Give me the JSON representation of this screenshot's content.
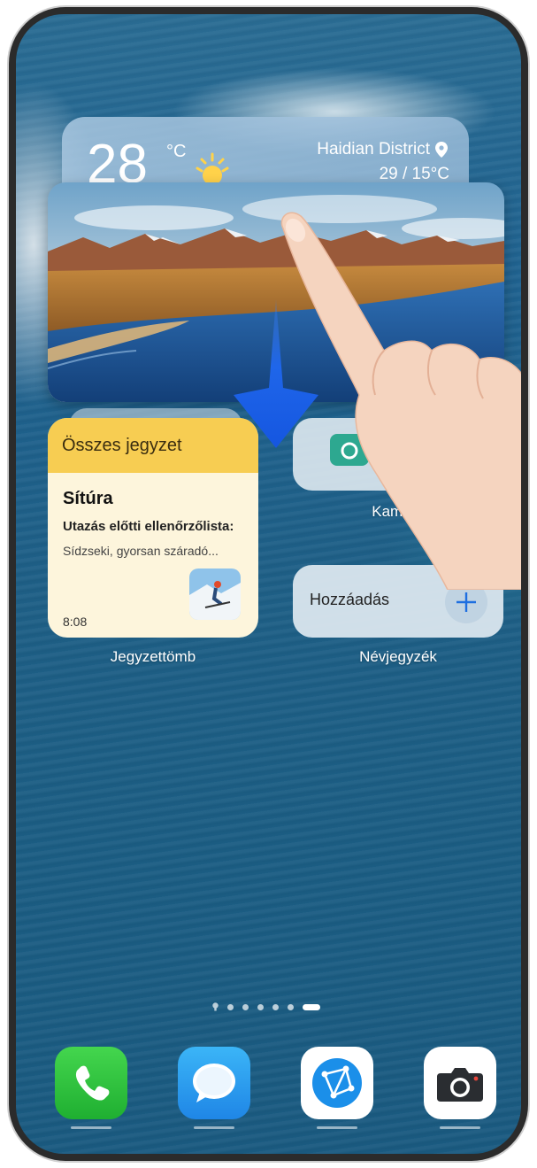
{
  "weather": {
    "temperature": "28",
    "unit": "°C",
    "location": "Haidian District",
    "range": "29 / 15°C",
    "icon": "sun-icon"
  },
  "notes_widget": {
    "header": "Összes jegyzet",
    "title": "Sítúra",
    "line1": "Utazás előtti ellenőrzőlista:",
    "line2": "Sídzseki, gyorsan száradó...",
    "time": "8:08",
    "app_label": "Jegyzettömb"
  },
  "camera_widget": {
    "app_label": "Kamera",
    "icon": "camera-icon"
  },
  "contacts_widget": {
    "button_text": "Hozzáadás",
    "app_label": "Névjegyzék",
    "icon": "plus-icon"
  },
  "page_indicator": {
    "total_pages": 7,
    "active_page": 7
  },
  "dock": {
    "apps": [
      {
        "name": "Phone",
        "icon": "phone-icon",
        "color": "#2ec43d"
      },
      {
        "name": "Messages",
        "icon": "message-bubble-icon",
        "color": "#2e9ff0"
      },
      {
        "name": "Browser",
        "icon": "browser-icon",
        "color": "#ffffff"
      },
      {
        "name": "Camera",
        "icon": "camera-icon",
        "color": "#ffffff"
      }
    ]
  },
  "gesture": {
    "direction": "down",
    "arrow_color": "#1e63e8"
  }
}
